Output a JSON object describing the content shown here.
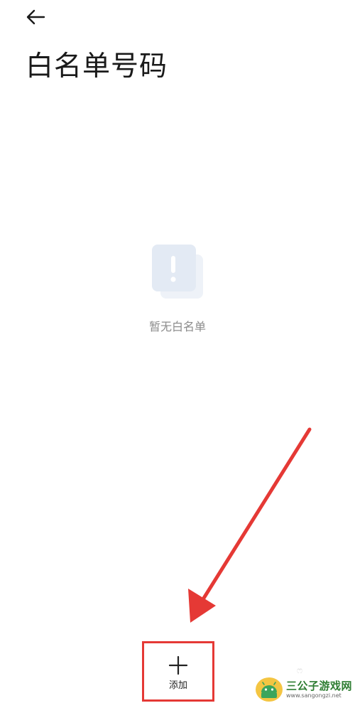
{
  "header": {
    "title": "白名单号码"
  },
  "empty_state": {
    "icon": "exclamation-card-icon",
    "message": "暂无白名单"
  },
  "bottom_bar": {
    "add_label": "添加",
    "add_icon": "plus-icon"
  },
  "annotation": {
    "arrow_color": "#e53935",
    "highlight_color": "#e53935"
  },
  "watermark": {
    "name": "三公子游戏网",
    "url": "www.sangongzi.net"
  },
  "colors": {
    "background": "#ffffff",
    "title": "#1a1a1a",
    "muted_text": "#8c8c8c",
    "empty_icon": "#e6edf6"
  }
}
